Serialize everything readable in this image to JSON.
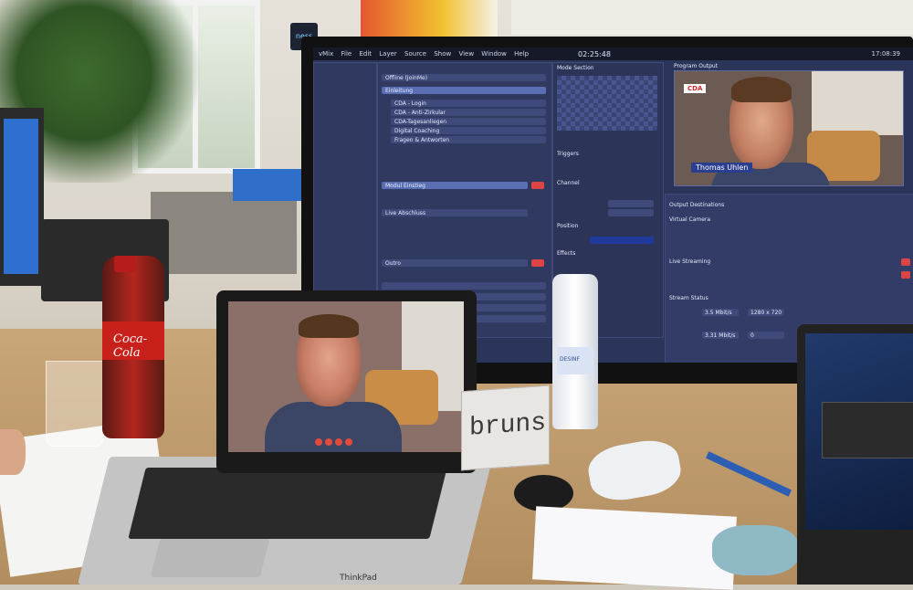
{
  "scene": {
    "description_labels": {
      "monitor": "streaming-control-monitor",
      "laptop": "video-call-laptop"
    }
  },
  "stream_app": {
    "menu": [
      "vMix",
      "File",
      "Edit",
      "Layer",
      "Source",
      "Show",
      "View",
      "Window",
      "Help"
    ],
    "timer": "02:25:48",
    "clock": "17:08:39",
    "program_title": "Program Output",
    "preview_title": "Mode Section",
    "lower_third": {
      "name": "Thomas Uhlen",
      "logo": "CDA"
    },
    "side_list": [
      "Offline (JoinMe)",
      "Einleitung",
      "CDA - Login",
      "CDA - Anti-Zirkular",
      "CDA-Tagesanliegen",
      "Digital Coaching",
      "Fragen & Antworten",
      "Modul Einstieg",
      "Live Abschluss",
      "Outro"
    ],
    "sections": [
      "Triggers",
      "Channel",
      "Position",
      "Effects",
      "Output Destinations",
      "Virtual Camera",
      "Live Streaming",
      "Stream Status"
    ],
    "stats": {
      "target_bitrate": "3.5 Mbit/s",
      "current_upload": "3.31 Mbit/s",
      "dropped": "0",
      "resolution": "1280 x 720"
    }
  },
  "laptop": {
    "brand": "ThinkPad",
    "call_controls": [
      "mute",
      "video",
      "end-call",
      "share"
    ]
  },
  "desk_items": {
    "bottle_label": "Coca-Cola",
    "nameplate": "bruns",
    "spray_label": "DESINF",
    "ness_sign": "ness"
  }
}
